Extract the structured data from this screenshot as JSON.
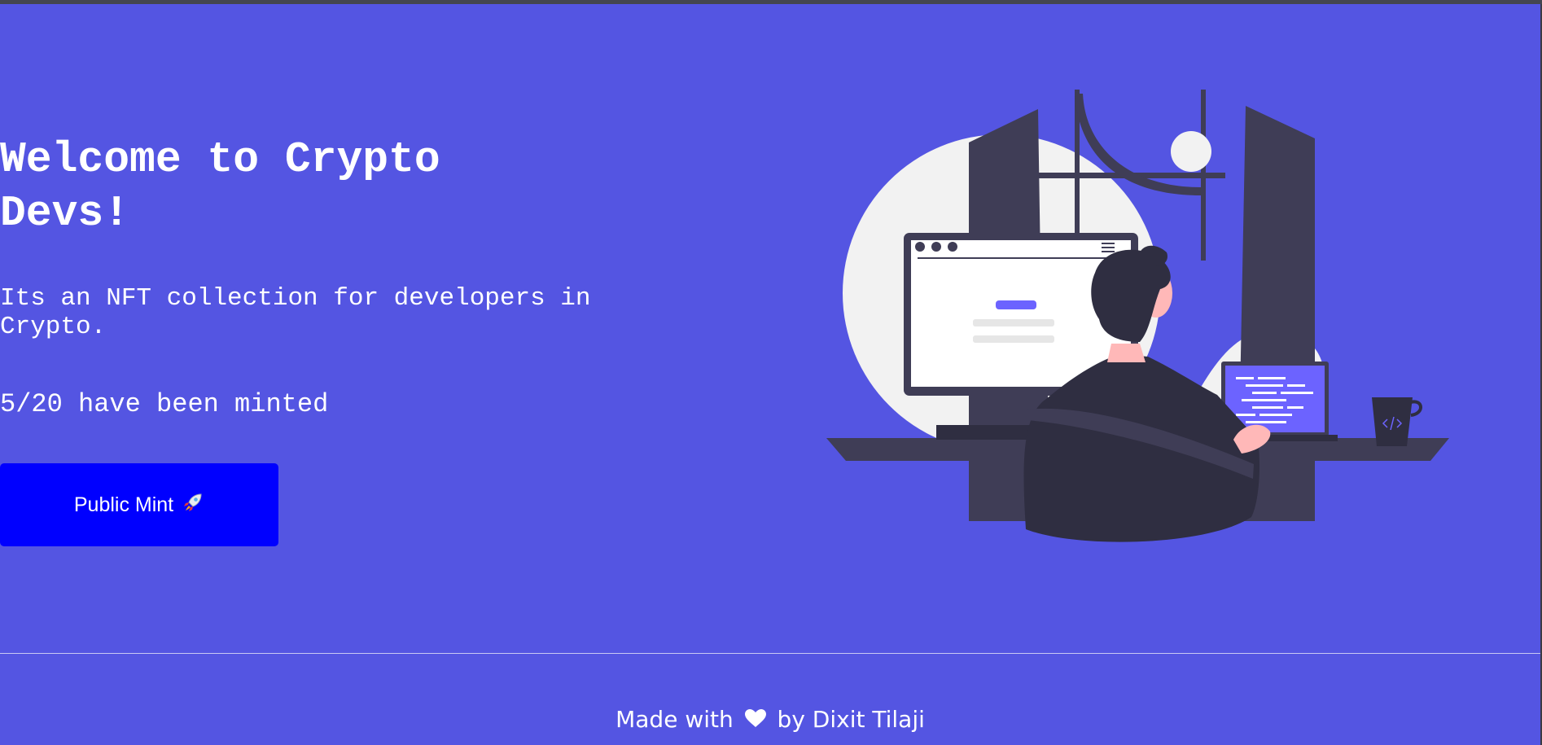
{
  "hero": {
    "title": "Welcome to Crypto Devs!",
    "description": "Its an NFT collection for developers in Crypto.",
    "minted_status": "5/20 have been minted"
  },
  "mint_button": {
    "label": "Public Mint",
    "icon": "rocket-icon"
  },
  "illustration": {
    "icon": "developer-at-desk-illustration"
  },
  "footer": {
    "prefix": "Made with",
    "icon": "heart-icon",
    "suffix": "by Dixit Tilaji"
  },
  "colors": {
    "background": "#5455e2",
    "button": "#0000ff",
    "text": "#ffffff",
    "illustration_dark": "#3f3d56",
    "illustration_light": "#f2f2f2",
    "illustration_accent": "#6c63ff",
    "skin": "#ffb8b8"
  }
}
